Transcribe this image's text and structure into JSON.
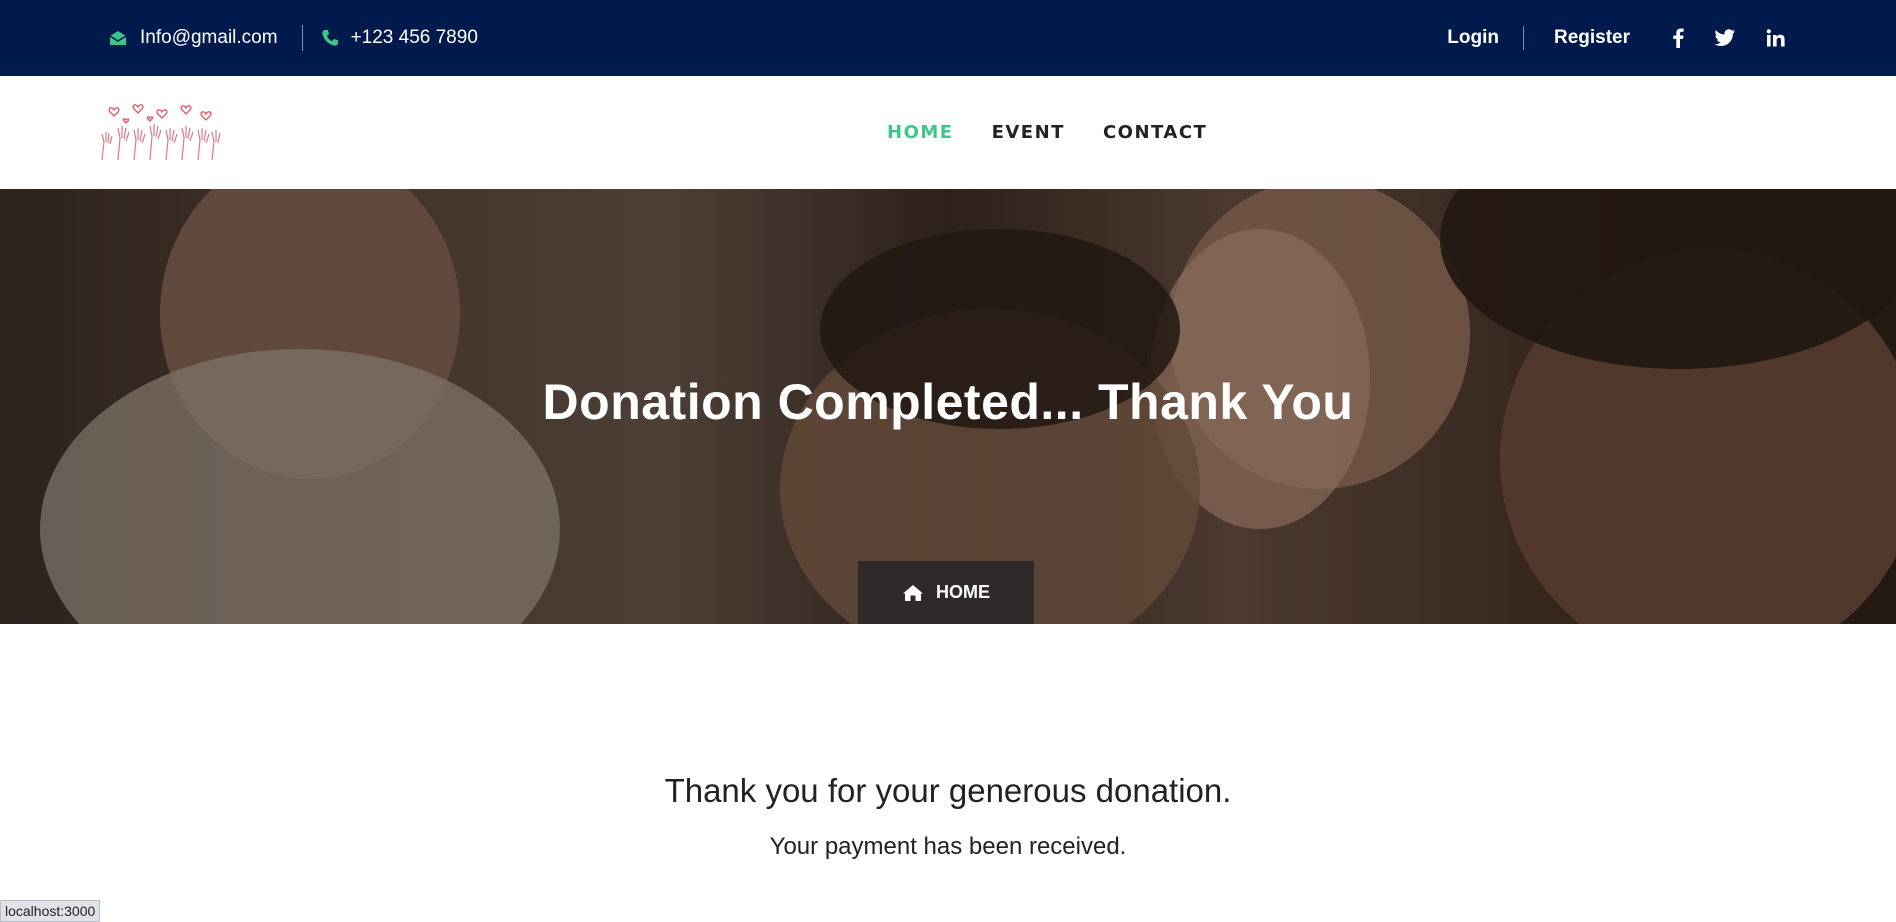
{
  "topbar": {
    "email": "Info@gmail.com",
    "phone": "+123 456 7890",
    "login": "Login",
    "register": "Register",
    "social": [
      "facebook-icon",
      "twitter-icon",
      "linkedin-icon"
    ],
    "email_icon": "envelope-icon",
    "phone_icon": "phone-icon",
    "bg_color": "#001a4d",
    "accent_color": "#3cc68a"
  },
  "nav": {
    "items": [
      {
        "label": "HOME",
        "active": true
      },
      {
        "label": "EVENT",
        "active": false
      },
      {
        "label": "CONTACT",
        "active": false
      }
    ]
  },
  "hero": {
    "title": "Donation Completed... Thank You",
    "breadcrumb": "HOME",
    "breadcrumb_icon": "home-icon"
  },
  "content": {
    "heading": "Thank you for your generous donation.",
    "subtext": "Your payment has been received."
  },
  "status": {
    "url": "localhost:3000"
  }
}
